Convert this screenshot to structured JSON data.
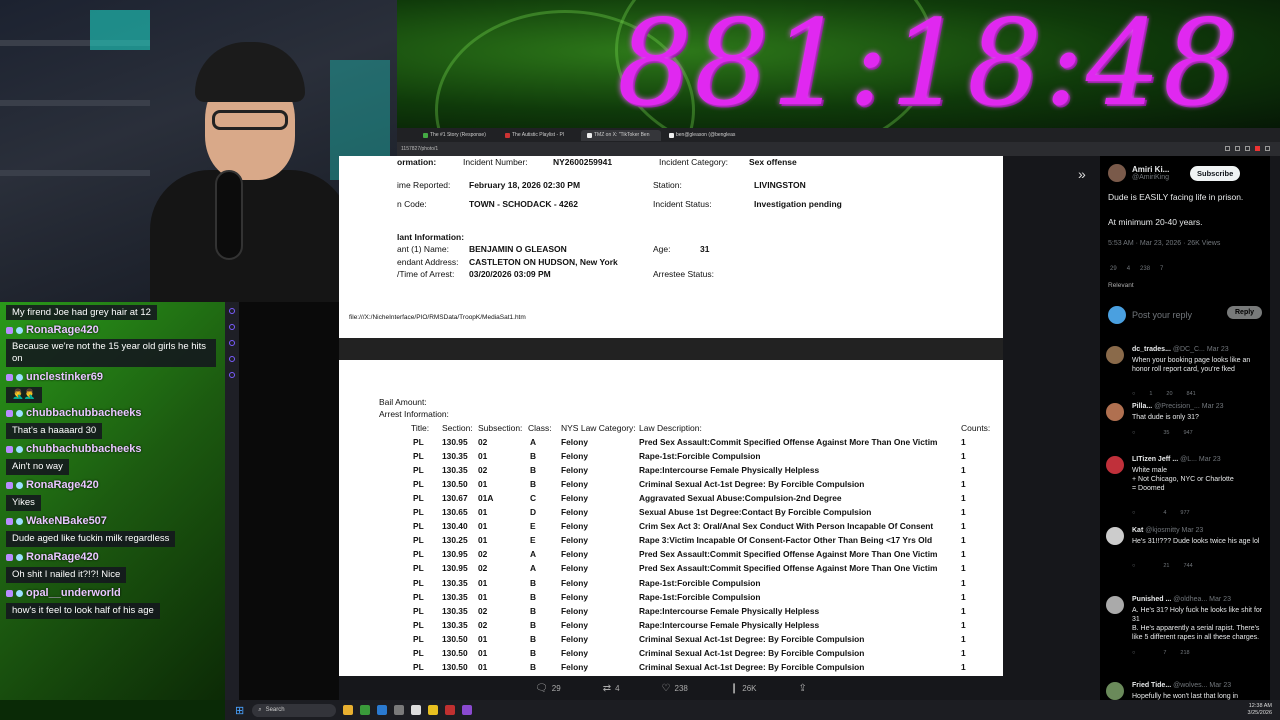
{
  "overlay": {
    "timer": "881:18:48"
  },
  "browser": {
    "tabs": [
      "The #1 Story (Response)",
      "The Autistic Playlist - Pl",
      "TMZ on X: \"TikToker Ben",
      "ben@gleason (@bengleas"
    ],
    "url": "1157827/photo/1"
  },
  "document": {
    "page1": {
      "info_label": "ormation:",
      "incident_number_label": "Incident Number:",
      "incident_number": "NY2600259941",
      "incident_category_label": "Incident Category:",
      "incident_category": "Sex offense",
      "time_reported_label": "ime Reported:",
      "time_reported": "February 18, 2026 02:30 PM",
      "station_label": "Station:",
      "station": "LIVINGSTON",
      "code_label": "n Code:",
      "code": "TOWN - SCHODACK - 4262",
      "incident_status_label": "Incident Status:",
      "incident_status": "Investigation pending",
      "defendant_info_label": "lant Information:",
      "name_label": "ant (1) Name:",
      "name": "BENJAMIN O GLEASON",
      "age_label": "Age:",
      "age": "31",
      "address_label": "endant Address:",
      "address": "CASTLETON ON HUDSON, New York",
      "arrest_time_label": "/Time of Arrest:",
      "arrest_time": "03/20/2026 03:09 PM",
      "arrestee_status_label": "Arrestee Status:",
      "file_path": "file:///X:/NicheInterface/PIO/RMSData/TroopK/MediaSat1.htm"
    },
    "page2": {
      "bail_label": "Bail Amount:",
      "arrest_info_label": "Arrest Information:",
      "headers": [
        "Title:",
        "Section:",
        "Subsection:",
        "Class:",
        "NYS Law Category:",
        "Law Description:",
        "Counts:"
      ],
      "rows": [
        [
          "PL",
          "130.95",
          "02",
          "A",
          "Felony",
          "Pred Sex Assault:Commit Specified Offense Against More Than One Victim",
          "1"
        ],
        [
          "PL",
          "130.35",
          "01",
          "B",
          "Felony",
          "Rape-1st:Forcible Compulsion",
          "1"
        ],
        [
          "PL",
          "130.35",
          "02",
          "B",
          "Felony",
          "Rape:Intercourse Female Physically Helpless",
          "1"
        ],
        [
          "PL",
          "130.50",
          "01",
          "B",
          "Felony",
          "Criminal Sexual Act-1st Degree: By Forcible Compulsion",
          "1"
        ],
        [
          "PL",
          "130.67",
          "01A",
          "C",
          "Felony",
          "Aggravated Sexual Abuse:Compulsion-2nd Degree",
          "1"
        ],
        [
          "PL",
          "130.65",
          "01",
          "D",
          "Felony",
          "Sexual Abuse 1st Degree:Contact By Forcible Compulsion",
          "1"
        ],
        [
          "PL",
          "130.40",
          "01",
          "E",
          "Felony",
          "Crim Sex Act 3: Oral/Anal Sex Conduct With Person Incapable Of Consent",
          "1"
        ],
        [
          "PL",
          "130.25",
          "01",
          "E",
          "Felony",
          "Rape 3:Victim Incapable Of Consent-Factor Other Than Being <17 Yrs Old",
          "1"
        ],
        [
          "PL",
          "130.95",
          "02",
          "A",
          "Felony",
          "Pred Sex Assault:Commit Specified Offense Against More Than One Victim",
          "1"
        ],
        [
          "PL",
          "130.95",
          "02",
          "A",
          "Felony",
          "Pred Sex Assault:Commit Specified Offense Against More Than One Victim",
          "1"
        ],
        [
          "PL",
          "130.35",
          "01",
          "B",
          "Felony",
          "Rape-1st:Forcible Compulsion",
          "1"
        ],
        [
          "PL",
          "130.35",
          "01",
          "B",
          "Felony",
          "Rape-1st:Forcible Compulsion",
          "1"
        ],
        [
          "PL",
          "130.35",
          "02",
          "B",
          "Felony",
          "Rape:Intercourse Female Physically Helpless",
          "1"
        ],
        [
          "PL",
          "130.35",
          "02",
          "B",
          "Felony",
          "Rape:Intercourse Female Physically Helpless",
          "1"
        ],
        [
          "PL",
          "130.50",
          "01",
          "B",
          "Felony",
          "Criminal Sexual Act-1st Degree: By Forcible Compulsion",
          "1"
        ],
        [
          "PL",
          "130.50",
          "01",
          "B",
          "Felony",
          "Criminal Sexual Act-1st Degree: By Forcible Compulsion",
          "1"
        ],
        [
          "PL",
          "130.50",
          "01",
          "B",
          "Felony",
          "Criminal Sexual Act-1st Degree: By Forcible Compulsion",
          "1"
        ]
      ]
    }
  },
  "post_actions": {
    "replies": "29",
    "reposts": "4",
    "likes": "238",
    "views": "26K"
  },
  "x_panel": {
    "author": "Amiri Ki...",
    "handle": "@AmiriKing",
    "subscribe": "Subscribe",
    "line1": "Dude is EASILY facing life in prison.",
    "line2": "At minimum 20-40 years.",
    "meta": "5:53 AM · Mar 23, 2026 · 26K Views",
    "stats": [
      "29",
      "4",
      "238",
      "7"
    ],
    "relevant": "Relevant",
    "reply_placeholder": "Post your reply",
    "reply_button": "Reply",
    "replies": [
      {
        "name": "dc_trades...",
        "handle": "@DC_C...",
        "date": "Mar 23",
        "text": "When your booking page looks like an honor roll report card, you're fked",
        "stats": [
          "1",
          "20",
          "841"
        ],
        "avatar": "#8a6a4a"
      },
      {
        "name": "Pilla...",
        "handle": "@Precision_...",
        "date": "Mar 23",
        "text": "That dude is only 31?",
        "stats": [
          "",
          "35",
          "947"
        ],
        "avatar": "#b07050"
      },
      {
        "name": "LITizen Jeff ...",
        "handle": "@L...",
        "date": "Mar 23",
        "text": "White male\n+ Not Chicago, NYC or Charlotte\n= Doomed",
        "stats": [
          "",
          "4",
          "977"
        ],
        "avatar": "#c0303a"
      },
      {
        "name": "Kat",
        "handle": "@kjosmitty",
        "date": "Mar 23",
        "text": "He's 31!!??? Dude looks twice his age lol",
        "stats": [
          "",
          "21",
          "744"
        ],
        "avatar": "#ccc"
      },
      {
        "name": "Punished ...",
        "handle": "@oldhea...",
        "date": "Mar 23",
        "text": "A. He's 31? Holy fuck he looks like shit for 31\nB. He's apparently a serial rapist. There's like 5 different rapes in all these charges.",
        "stats": [
          "",
          "7",
          "218"
        ],
        "avatar": "#aaa"
      },
      {
        "name": "Fried Tide...",
        "handle": "@wolves...",
        "date": "Mar 23",
        "text": "Hopefully he won't last that long in",
        "stats": [],
        "avatar": "#6a8a5a"
      }
    ]
  },
  "chat": {
    "first_message": "My firend Joe had grey hair at 12",
    "messages": [
      {
        "user": "RonaRage420",
        "text": "Because we're not the 15 year old girls he hits on"
      },
      {
        "user": "unclestinker69",
        "text": "🤦‍♂️🤦‍♂️"
      },
      {
        "user": "chubbachubbacheeks",
        "text": "That's a haaaard 30"
      },
      {
        "user": "chubbachubbacheeks",
        "text": "Ain't no way"
      },
      {
        "user": "RonaRage420",
        "text": "Yikes"
      },
      {
        "user": "WakeNBake507",
        "text": "Dude aged like fuckin milk regardless"
      },
      {
        "user": "RonaRage420",
        "text": "Oh shit I nailed it?!?! Nice"
      },
      {
        "user": "opal__underworld",
        "text": "how's it feel to look half of his age"
      }
    ]
  },
  "taskbar": {
    "search": "Search",
    "time": "12:38 AM",
    "date": "3/25/2026"
  }
}
